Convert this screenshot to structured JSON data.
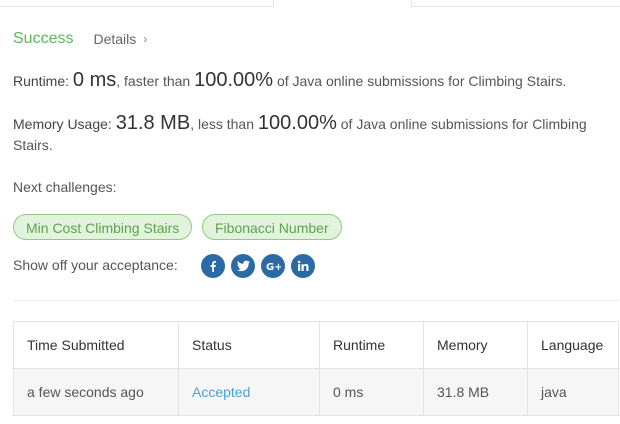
{
  "status": {
    "result": "Success",
    "details_label": "Details"
  },
  "runtime": {
    "label": "Runtime:",
    "value": "0 ms",
    "compare_text": ", faster than",
    "percent": "100.00%",
    "suffix": "of Java online submissions for Climbing Stairs."
  },
  "memory": {
    "label": "Memory Usage:",
    "value": "31.8 MB",
    "compare_text": ", less than",
    "percent": "100.00%",
    "suffix": "of Java online submissions for Climbing Stairs."
  },
  "next_challenges": {
    "label": "Next challenges:",
    "items": [
      "Min Cost Climbing Stairs",
      "Fibonacci Number"
    ]
  },
  "share": {
    "label": "Show off your acceptance:",
    "icons": [
      "facebook-icon",
      "twitter-icon",
      "google-plus-icon",
      "linkedin-icon"
    ]
  },
  "table": {
    "headers": [
      "Time Submitted",
      "Status",
      "Runtime",
      "Memory",
      "Language"
    ],
    "rows": [
      [
        "a few seconds ago",
        "Accepted",
        "0 ms",
        "31.8 MB",
        "java"
      ]
    ]
  },
  "colors": {
    "success": "#5cb85c",
    "challenge_bg": "#e1f3dc",
    "challenge_border": "#8fcc80",
    "social": "#2c6aa6",
    "accepted_link": "#4aa3d8"
  }
}
